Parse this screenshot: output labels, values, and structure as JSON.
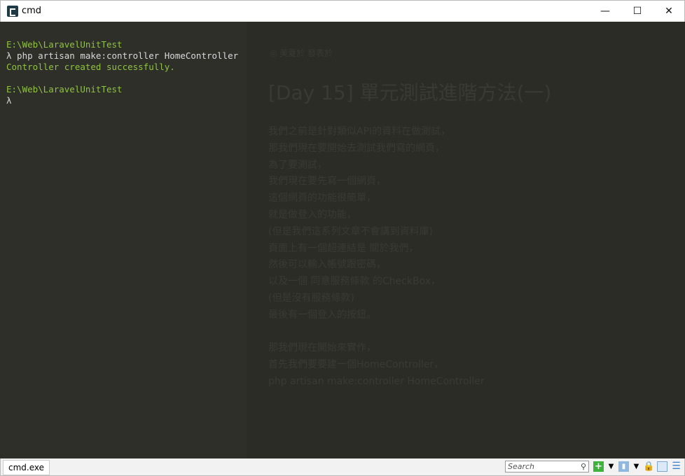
{
  "window": {
    "title": "cmd",
    "minimize": "—",
    "maximize": "☐",
    "close": "✕"
  },
  "terminal": {
    "lines": [
      {
        "text": "E:\\Web\\LaravelUnitTest",
        "color": "green"
      },
      {
        "text": "λ php artisan make:controller HomeController",
        "color": "white"
      },
      {
        "text": "Controller created successfully.",
        "color": "green"
      },
      {
        "text": "",
        "color": "white"
      },
      {
        "text": "E:\\Web\\LaravelUnitTest",
        "color": "green"
      },
      {
        "text": "λ",
        "color": "white"
      }
    ]
  },
  "background_page": {
    "author": "◎ 美夏於 發表於",
    "title": "[Day 15] 單元測試進階方法(一)",
    "paragraph": [
      "我們之前是針對類似API的資料在做測試，",
      "那我們現在要開始去測試我們寫的網頁，",
      "為了要測試，",
      "我們現在要先寫一個網頁，",
      "這個網頁的功能很簡單，",
      "就是做登入的功能，",
      "(但是我們這系列文章不會講到資料庫)",
      "頁面上有一個超連結是 關於我們，",
      "然後可以輸入帳號跟密碼，",
      "以及一個 同意服務條款 的CheckBox，",
      "(但是沒有服務條款)",
      "最後有一個登入的按鈕。",
      "",
      "那我們現在開始來實作，",
      "首先我們要要建一個HomeController，",
      "php artisan make:controller HomeController"
    ]
  },
  "statusbar": {
    "tab": "cmd.exe",
    "search_placeholder": "Search",
    "icons": [
      "add-console-icon",
      "dropdown-icon",
      "tab-icon",
      "dropdown-icon",
      "lock-icon",
      "split-view-icon",
      "menu-icon"
    ]
  },
  "colors": {
    "prompt_green": "#8ec33e",
    "text": "#d8d8d8",
    "background": "#2c2c27"
  }
}
